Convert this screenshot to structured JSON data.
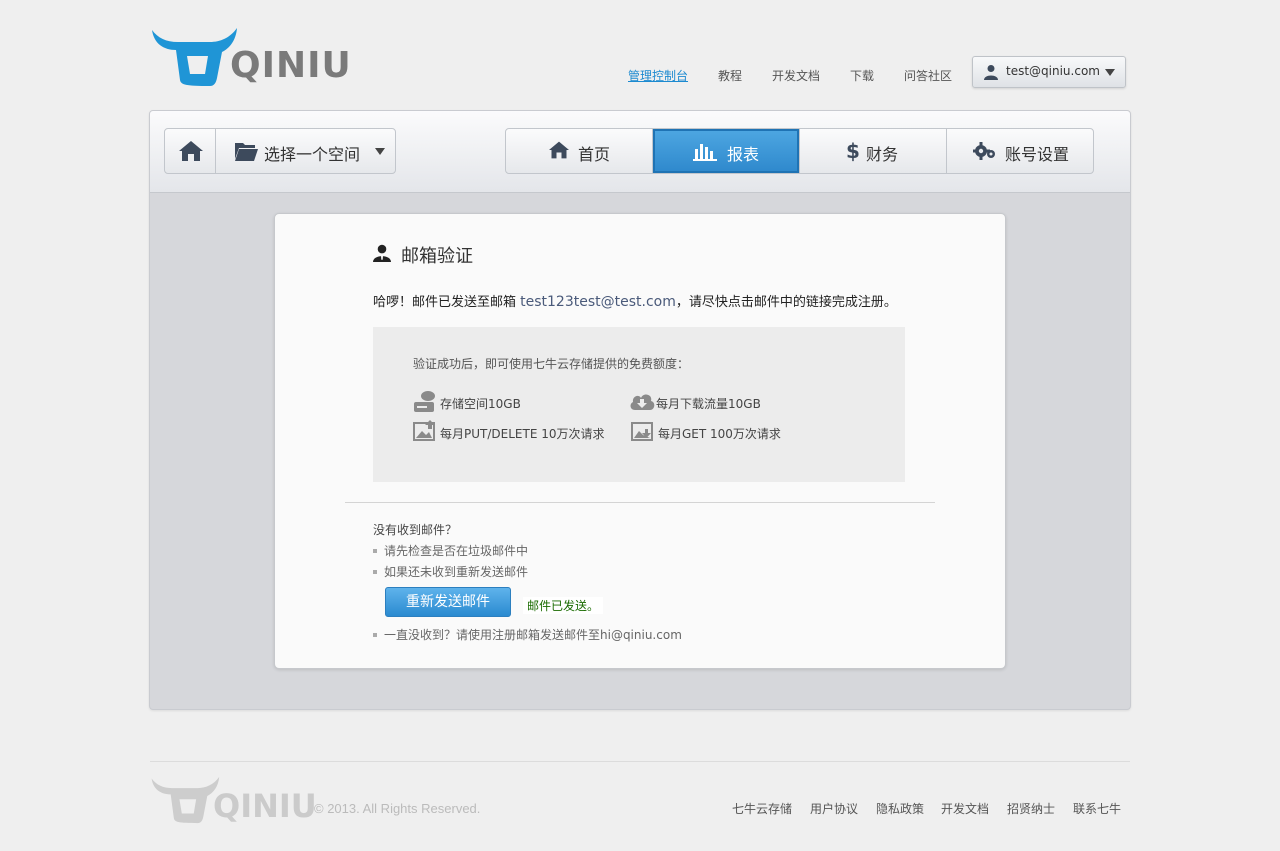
{
  "brand": {
    "name": "QINIU",
    "accent": "#1c8ad0"
  },
  "topnav": {
    "items": [
      {
        "label": "管理控制台",
        "active": true
      },
      {
        "label": "教程"
      },
      {
        "label": "开发文档"
      },
      {
        "label": "下载"
      },
      {
        "label": "问答社区"
      }
    ]
  },
  "user": {
    "email": "test@qiniu.com"
  },
  "toolbar": {
    "space_select": "选择一个空间",
    "tabs": [
      {
        "label": "首页",
        "icon": "home-icon"
      },
      {
        "label": "报表",
        "icon": "bar-chart-icon",
        "active": true
      },
      {
        "label": "财务",
        "icon": "dollar-icon"
      },
      {
        "label": "账号设置",
        "icon": "gear-icon"
      }
    ]
  },
  "card": {
    "title": "邮箱验证",
    "message_prefix": "哈啰！邮件已发送至邮箱 ",
    "email": "test123test@test.com",
    "message_suffix": "，请尽快点击邮件中的链接完成注册。",
    "quota_title": "验证成功后，即可使用七牛云存储提供的免费额度：",
    "quota_items": [
      {
        "label": "存储空间10GB",
        "icon": "storage-icon"
      },
      {
        "label": "每月下载流量10GB",
        "icon": "cloud-download-icon"
      },
      {
        "label": "每月PUT/DELETE 10万次请求",
        "icon": "image-upload-icon"
      },
      {
        "label": "每月GET 100万次请求",
        "icon": "image-download-icon"
      }
    ],
    "help_title": "没有收到邮件？",
    "help_items": [
      "请先检查是否在垃圾邮件中",
      "如果还未收到重新发送邮件"
    ],
    "resend_label": "重新发送邮件",
    "sent_status": "邮件已发送。",
    "contact_note": "一直没收到？请使用注册邮箱发送邮件至hi@qiniu.com"
  },
  "footer": {
    "copyright": "© 2013. All Rights Reserved.",
    "links": [
      "七牛云存储",
      "用户协议",
      "隐私政策",
      "开发文档",
      "招贤纳士",
      "联系七牛"
    ]
  }
}
